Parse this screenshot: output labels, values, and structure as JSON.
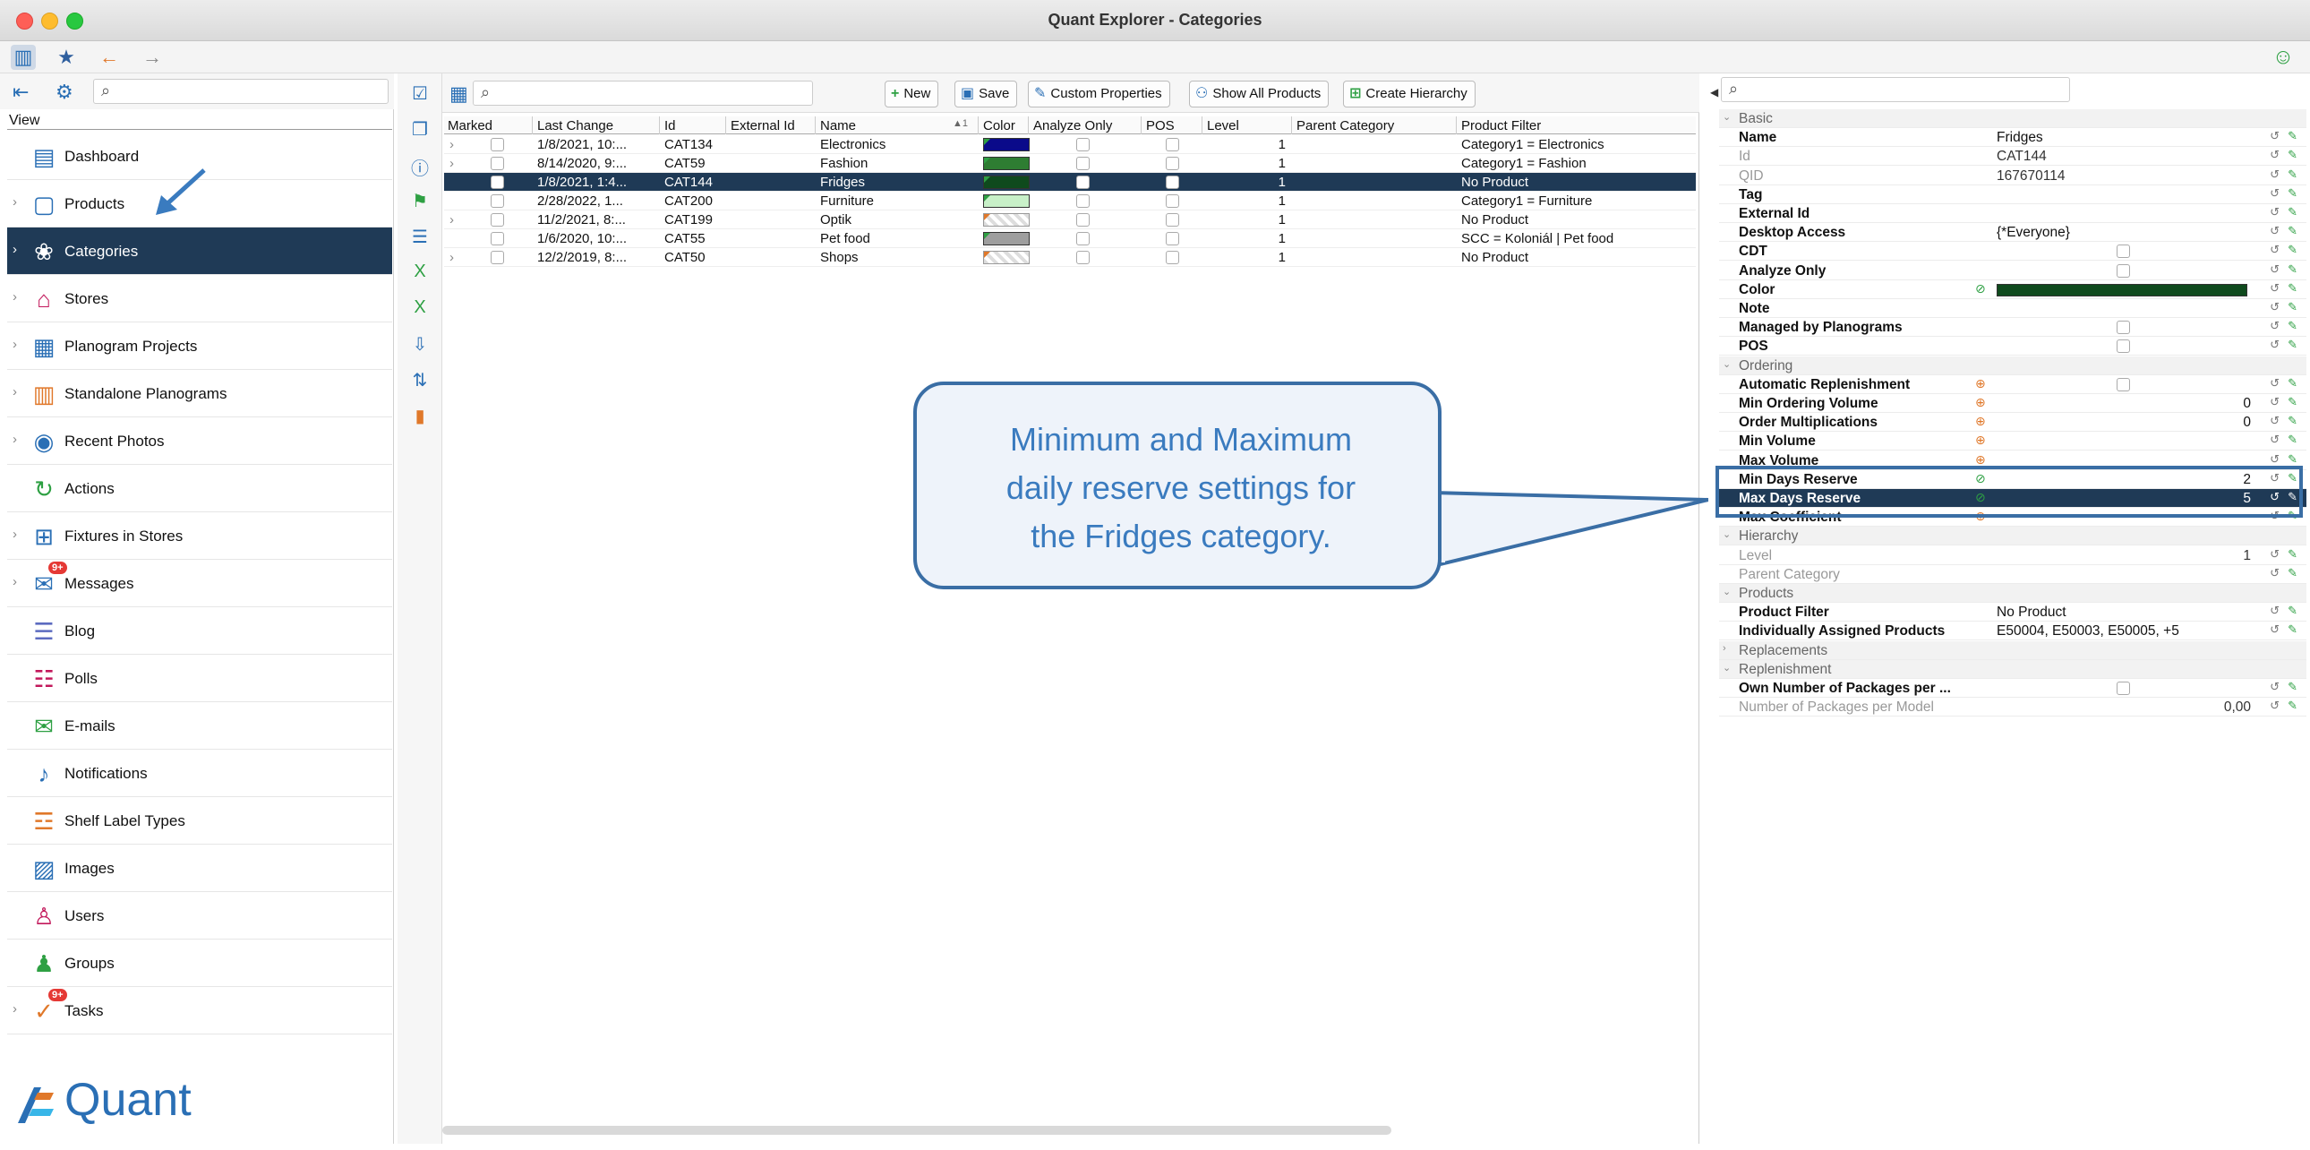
{
  "window": {
    "title": "Quant Explorer - Categories"
  },
  "sidebar": {
    "view_label": "View",
    "items": [
      {
        "label": "Dashboard",
        "icon": "dashboard-icon",
        "chevron": false,
        "badge": ""
      },
      {
        "label": "Products",
        "icon": "products-icon",
        "chevron": true,
        "badge": ""
      },
      {
        "label": "Categories",
        "icon": "categories-icon",
        "chevron": true,
        "badge": ""
      },
      {
        "label": "Stores",
        "icon": "stores-icon",
        "chevron": true,
        "badge": ""
      },
      {
        "label": "Planogram Projects",
        "icon": "planogram-projects-icon",
        "chevron": true,
        "badge": ""
      },
      {
        "label": "Standalone Planograms",
        "icon": "standalone-planograms-icon",
        "chevron": true,
        "badge": ""
      },
      {
        "label": "Recent Photos",
        "icon": "camera-icon",
        "chevron": true,
        "badge": ""
      },
      {
        "label": "Actions",
        "icon": "actions-icon",
        "chevron": false,
        "badge": ""
      },
      {
        "label": "Fixtures in Stores",
        "icon": "fixtures-icon",
        "chevron": true,
        "badge": ""
      },
      {
        "label": "Messages",
        "icon": "messages-icon",
        "chevron": true,
        "badge": "9+"
      },
      {
        "label": "Blog",
        "icon": "blog-icon",
        "chevron": false,
        "badge": ""
      },
      {
        "label": "Polls",
        "icon": "polls-icon",
        "chevron": false,
        "badge": ""
      },
      {
        "label": "E-mails",
        "icon": "email-icon",
        "chevron": false,
        "badge": ""
      },
      {
        "label": "Notifications",
        "icon": "notifications-icon",
        "chevron": false,
        "badge": ""
      },
      {
        "label": "Shelf Label Types",
        "icon": "shelf-label-icon",
        "chevron": false,
        "badge": ""
      },
      {
        "label": "Images",
        "icon": "images-icon",
        "chevron": false,
        "badge": ""
      },
      {
        "label": "Users",
        "icon": "users-icon",
        "chevron": false,
        "badge": ""
      },
      {
        "label": "Groups",
        "icon": "groups-icon",
        "chevron": false,
        "badge": ""
      },
      {
        "label": "Tasks",
        "icon": "tasks-icon",
        "chevron": true,
        "badge": "9+"
      }
    ],
    "logo_text": "Quant"
  },
  "toolbar": {
    "new_label": "New",
    "save_label": "Save",
    "custom_properties_label": "Custom Properties",
    "show_all_products_label": "Show All Products",
    "create_hierarchy_label": "Create Hierarchy"
  },
  "grid": {
    "columns": [
      "Marked",
      "Last Change",
      "Id",
      "External Id",
      "Name",
      "Color",
      "Analyze Only",
      "POS",
      "Level",
      "Parent Category",
      "Product Filter"
    ],
    "sort_indicator": "1",
    "rows": [
      {
        "last_change": "1/8/2021, 10:...",
        "id": "CAT134",
        "external_id": "",
        "name": "Electronics",
        "color": "#0a0a8a",
        "level": "1",
        "parent": "",
        "filter": "Category1  = Electronics",
        "expandable": true
      },
      {
        "last_change": "8/14/2020, 9:...",
        "id": "CAT59",
        "external_id": "",
        "name": "Fashion",
        "color": "#2e7d32",
        "level": "1",
        "parent": "",
        "filter": "Category1  = Fashion",
        "expandable": true
      },
      {
        "last_change": "1/8/2021, 1:4...",
        "id": "CAT144",
        "external_id": "",
        "name": "Fridges",
        "color": "#0f4a1d",
        "level": "1",
        "parent": "",
        "filter": "No Product",
        "expandable": false
      },
      {
        "last_change": "2/28/2022, 1...",
        "id": "CAT200",
        "external_id": "",
        "name": "Furniture",
        "color": "#c8f0c8",
        "level": "1",
        "parent": "",
        "filter": "Category1  = Furniture",
        "expandable": false
      },
      {
        "last_change": "11/2/2021, 8:...",
        "id": "CAT199",
        "external_id": "",
        "name": "Optik",
        "color": "checker",
        "level": "1",
        "parent": "",
        "filter": "No Product",
        "expandable": true
      },
      {
        "last_change": "1/6/2020, 10:...",
        "id": "CAT55",
        "external_id": "",
        "name": "Pet food",
        "color": "#9e9e9e",
        "level": "1",
        "parent": "",
        "filter": "SCC = Koloniál | Pet food",
        "expandable": false
      },
      {
        "last_change": "12/2/2019, 8:...",
        "id": "CAT50",
        "external_id": "",
        "name": "Shops",
        "color": "checker",
        "level": "1",
        "parent": "",
        "filter": "No Product",
        "expandable": true
      }
    ]
  },
  "callout": {
    "line1": "Minimum and Maximum",
    "line2": "daily reserve settings for",
    "line3": "the Fridges category."
  },
  "properties": {
    "rows": [
      {
        "type": "section",
        "label": "Basic"
      },
      {
        "label": "Name",
        "value": "Fridges",
        "bold": true
      },
      {
        "label": "Id",
        "value": "CAT144",
        "dim": true
      },
      {
        "label": "QID",
        "value": "167670114",
        "dim": true
      },
      {
        "label": "Tag",
        "value": "",
        "bold": true
      },
      {
        "label": "External Id",
        "value": "",
        "bold": true
      },
      {
        "label": "Desktop Access",
        "value": "{*Everyone}",
        "bold": true
      },
      {
        "label": "CDT",
        "value": "",
        "checkbox": true
      },
      {
        "label": "Analyze Only",
        "value": "",
        "checkbox": true
      },
      {
        "label": "Color",
        "value": "",
        "colorbar": true,
        "color": "#0f4a1d"
      },
      {
        "label": "Note",
        "value": ""
      },
      {
        "label": "Managed by Planograms",
        "value": "",
        "checkbox": true
      },
      {
        "label": "POS",
        "value": "",
        "checkbox": true
      },
      {
        "type": "section",
        "label": "Ordering"
      },
      {
        "label": "Automatic Replenishment",
        "value": "",
        "checkbox": true,
        "inherit": true
      },
      {
        "label": "Min Ordering Volume",
        "value": "0",
        "right": true,
        "inherit": true
      },
      {
        "label": "Order Multiplications",
        "value": "0",
        "right": true,
        "inherit": true
      },
      {
        "label": "Min Volume",
        "value": "",
        "inherit": true
      },
      {
        "label": "Max Volume",
        "value": "",
        "inherit": true
      },
      {
        "label": "Min Days Reserve",
        "value": "2",
        "right": true,
        "inherit_green": true
      },
      {
        "label": "Max Days Reserve",
        "value": "5",
        "right": true,
        "inherit_green": true,
        "selected": true
      },
      {
        "label": "Max Coefficient",
        "value": "",
        "inherit": true
      },
      {
        "type": "section",
        "label": "Hierarchy"
      },
      {
        "label": "Level",
        "value": "1",
        "right": true,
        "dim": true
      },
      {
        "label": "Parent Category",
        "value": "",
        "dim": true
      },
      {
        "type": "section",
        "label": "Products"
      },
      {
        "label": "Product Filter",
        "value": "No Product"
      },
      {
        "label": "Individually Assigned Products",
        "value": "E50004, E50003, E50005, +5"
      },
      {
        "type": "section",
        "label": "Replacements",
        "collapsed": true
      },
      {
        "type": "section",
        "label": "Replenishment"
      },
      {
        "label": "Own Number of Packages per ...",
        "value": "",
        "checkbox": true
      },
      {
        "label": "Number of Packages per Model",
        "value": "0,00",
        "right": true,
        "dim": true
      }
    ]
  }
}
